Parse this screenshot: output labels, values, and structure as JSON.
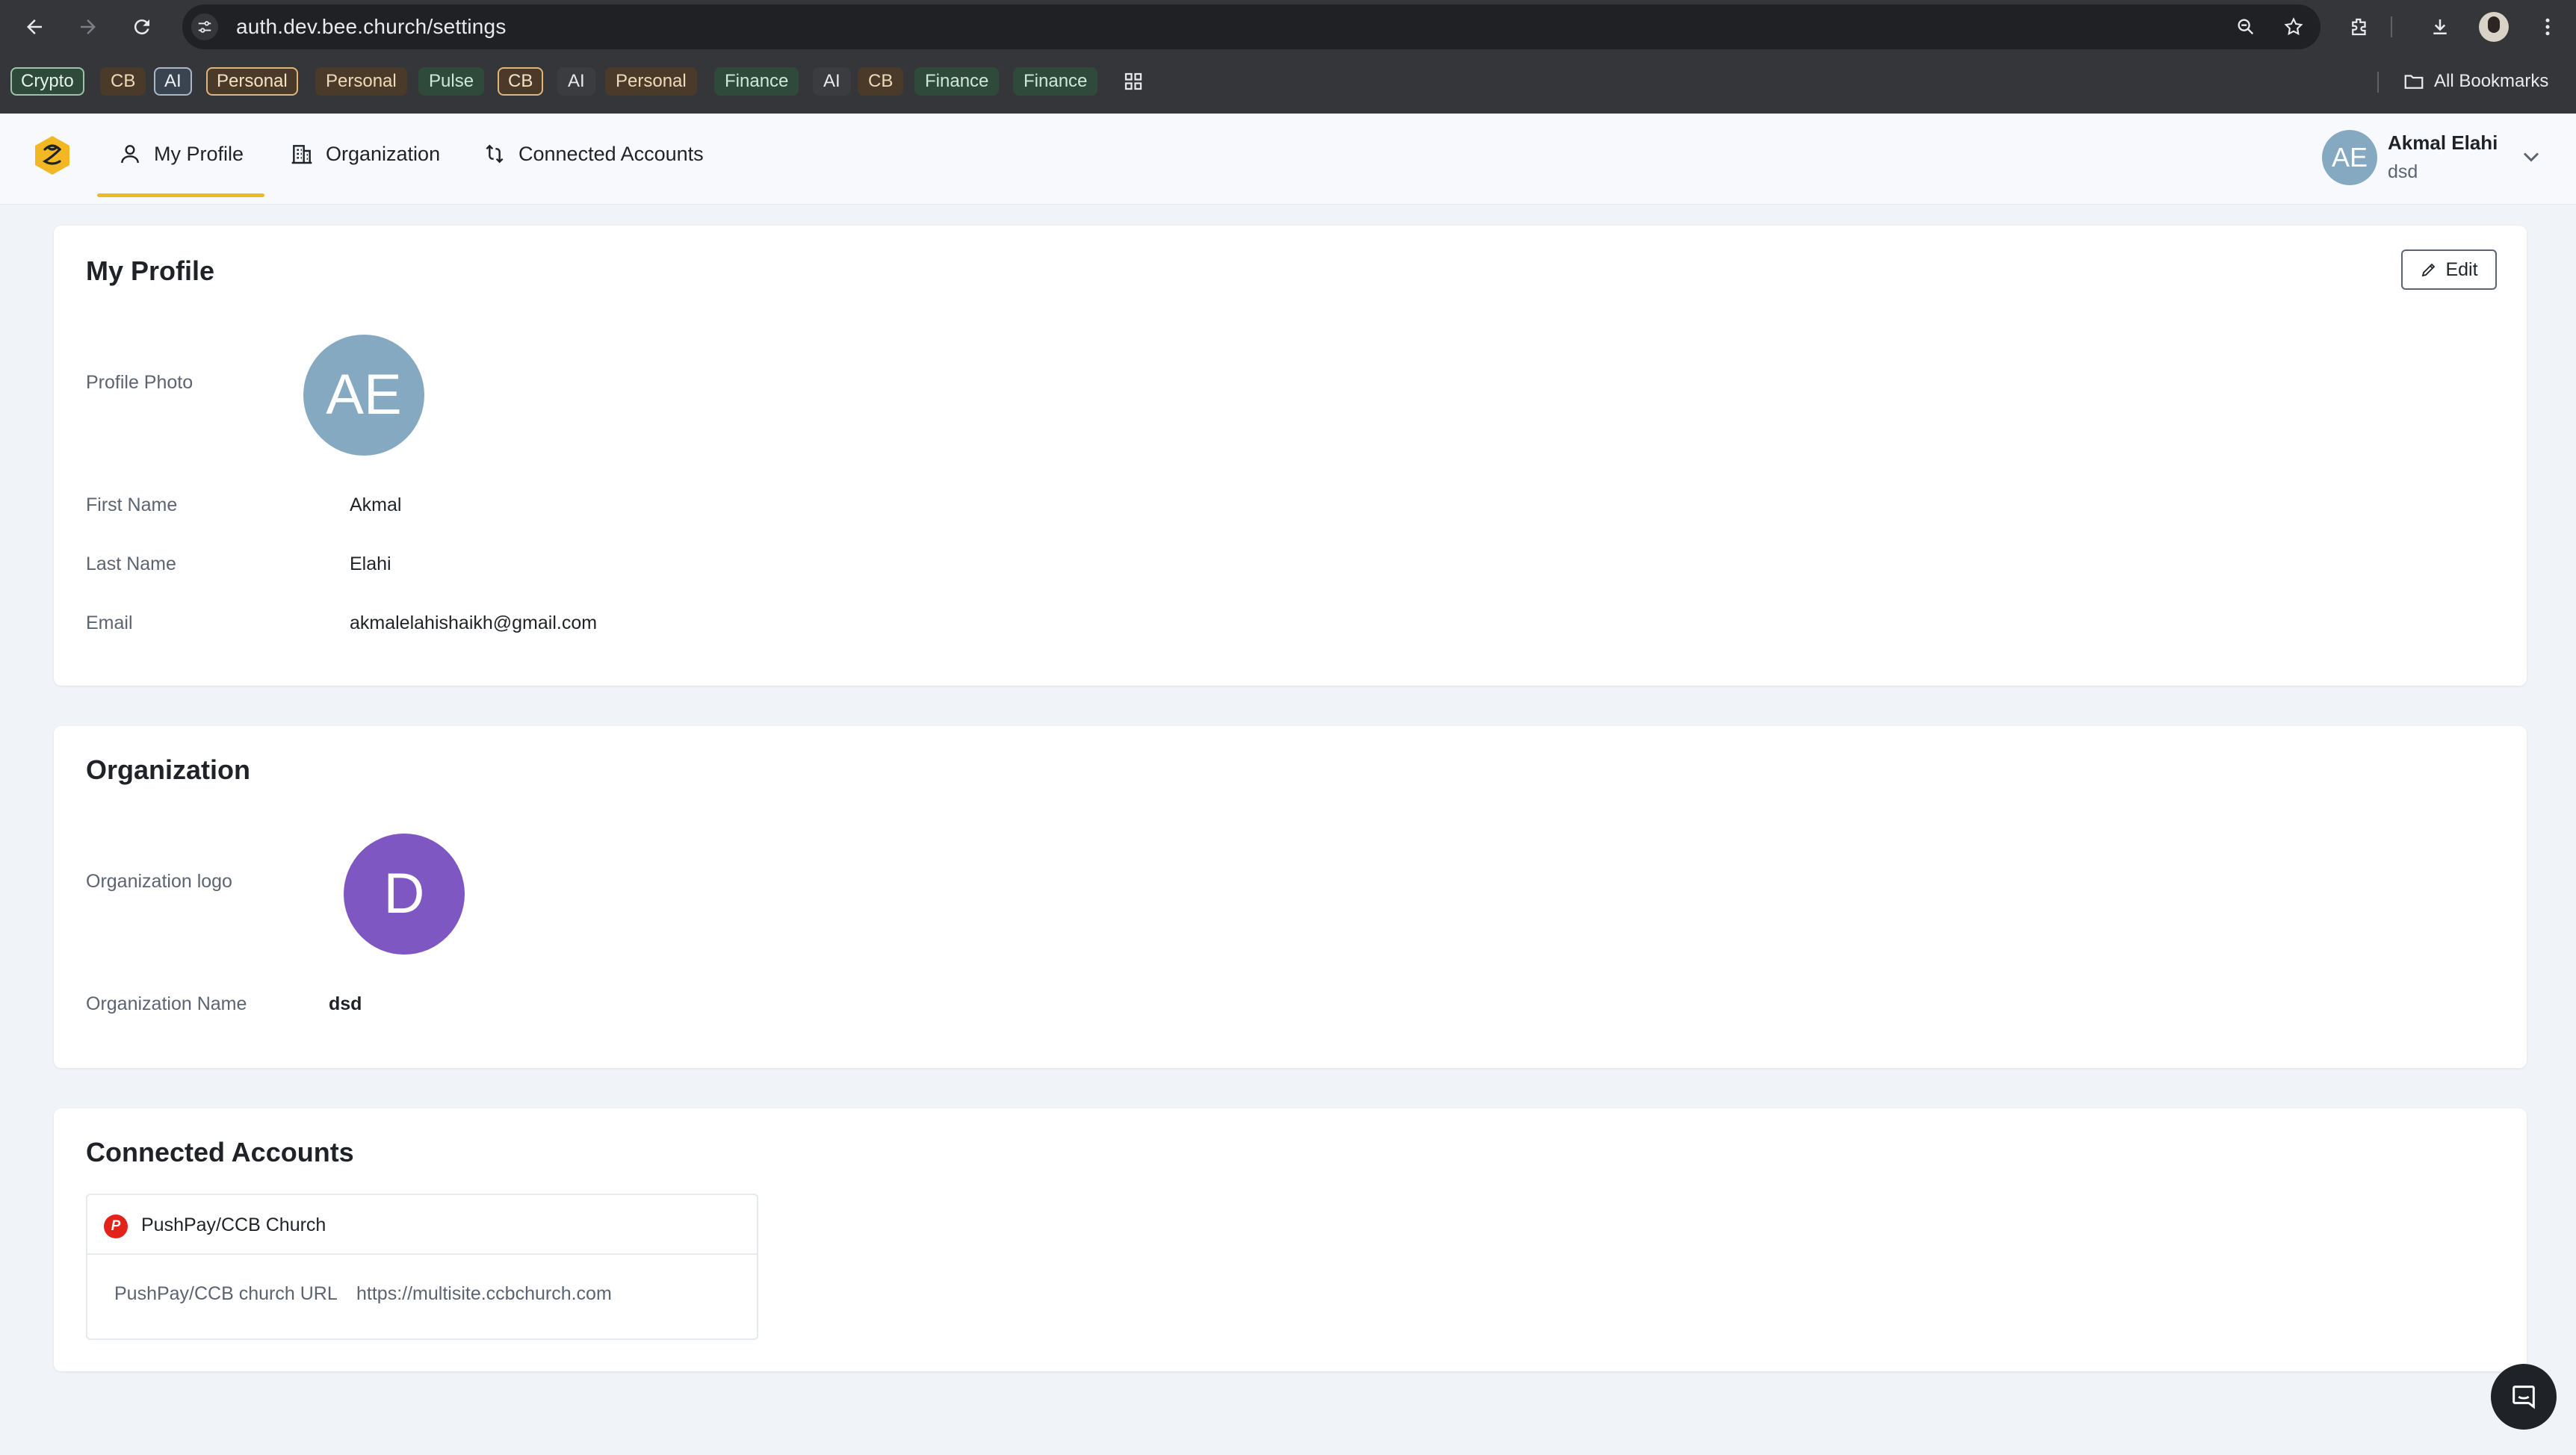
{
  "browser": {
    "url": "auth.dev.bee.church/settings",
    "bookmarks": [
      {
        "label": "Crypto",
        "style": "green-o"
      },
      {
        "label": "CB",
        "style": "brown"
      },
      {
        "label": "AI",
        "style": "slate-o"
      },
      {
        "label": "Personal",
        "style": "brown-o"
      },
      {
        "label": "Personal",
        "style": "brown"
      },
      {
        "label": "Pulse",
        "style": "green"
      },
      {
        "label": "CB",
        "style": "brown-o"
      },
      {
        "label": "AI",
        "style": "plain"
      },
      {
        "label": "Personal",
        "style": "brown"
      },
      {
        "label": "Finance",
        "style": "green"
      },
      {
        "label": "AI",
        "style": "plain"
      },
      {
        "label": "CB",
        "style": "brown"
      },
      {
        "label": "Finance",
        "style": "green"
      },
      {
        "label": "Finance",
        "style": "green"
      }
    ],
    "all_bookmarks": "All Bookmarks"
  },
  "header": {
    "tabs": {
      "profile": "My Profile",
      "organization": "Organization",
      "connected": "Connected Accounts"
    },
    "user": {
      "initials": "AE",
      "name": "Akmal Elahi",
      "org": "dsd"
    }
  },
  "profile": {
    "title": "My Profile",
    "edit_label": "Edit",
    "photo_label": "Profile Photo",
    "initials": "AE",
    "first_name_label": "First Name",
    "first_name": "Akmal",
    "last_name_label": "Last Name",
    "last_name": "Elahi",
    "email_label": "Email",
    "email": "akmalelahishaikh@gmail.com"
  },
  "organization": {
    "title": "Organization",
    "logo_label": "Organization logo",
    "logo_letter": "D",
    "name_label": "Organization Name",
    "name": "dsd"
  },
  "connected": {
    "title": "Connected Accounts",
    "account_name": "PushPay/CCB Church",
    "account_icon_letter": "P",
    "url_label": "PushPay/CCB church URL",
    "url": "https://multisite.ccbchurch.com"
  },
  "colors": {
    "accent": "#f2b824",
    "profile_avatar": "#86a9c2",
    "org_avatar": "#7e57c2",
    "pushpay": "#e2231a"
  }
}
